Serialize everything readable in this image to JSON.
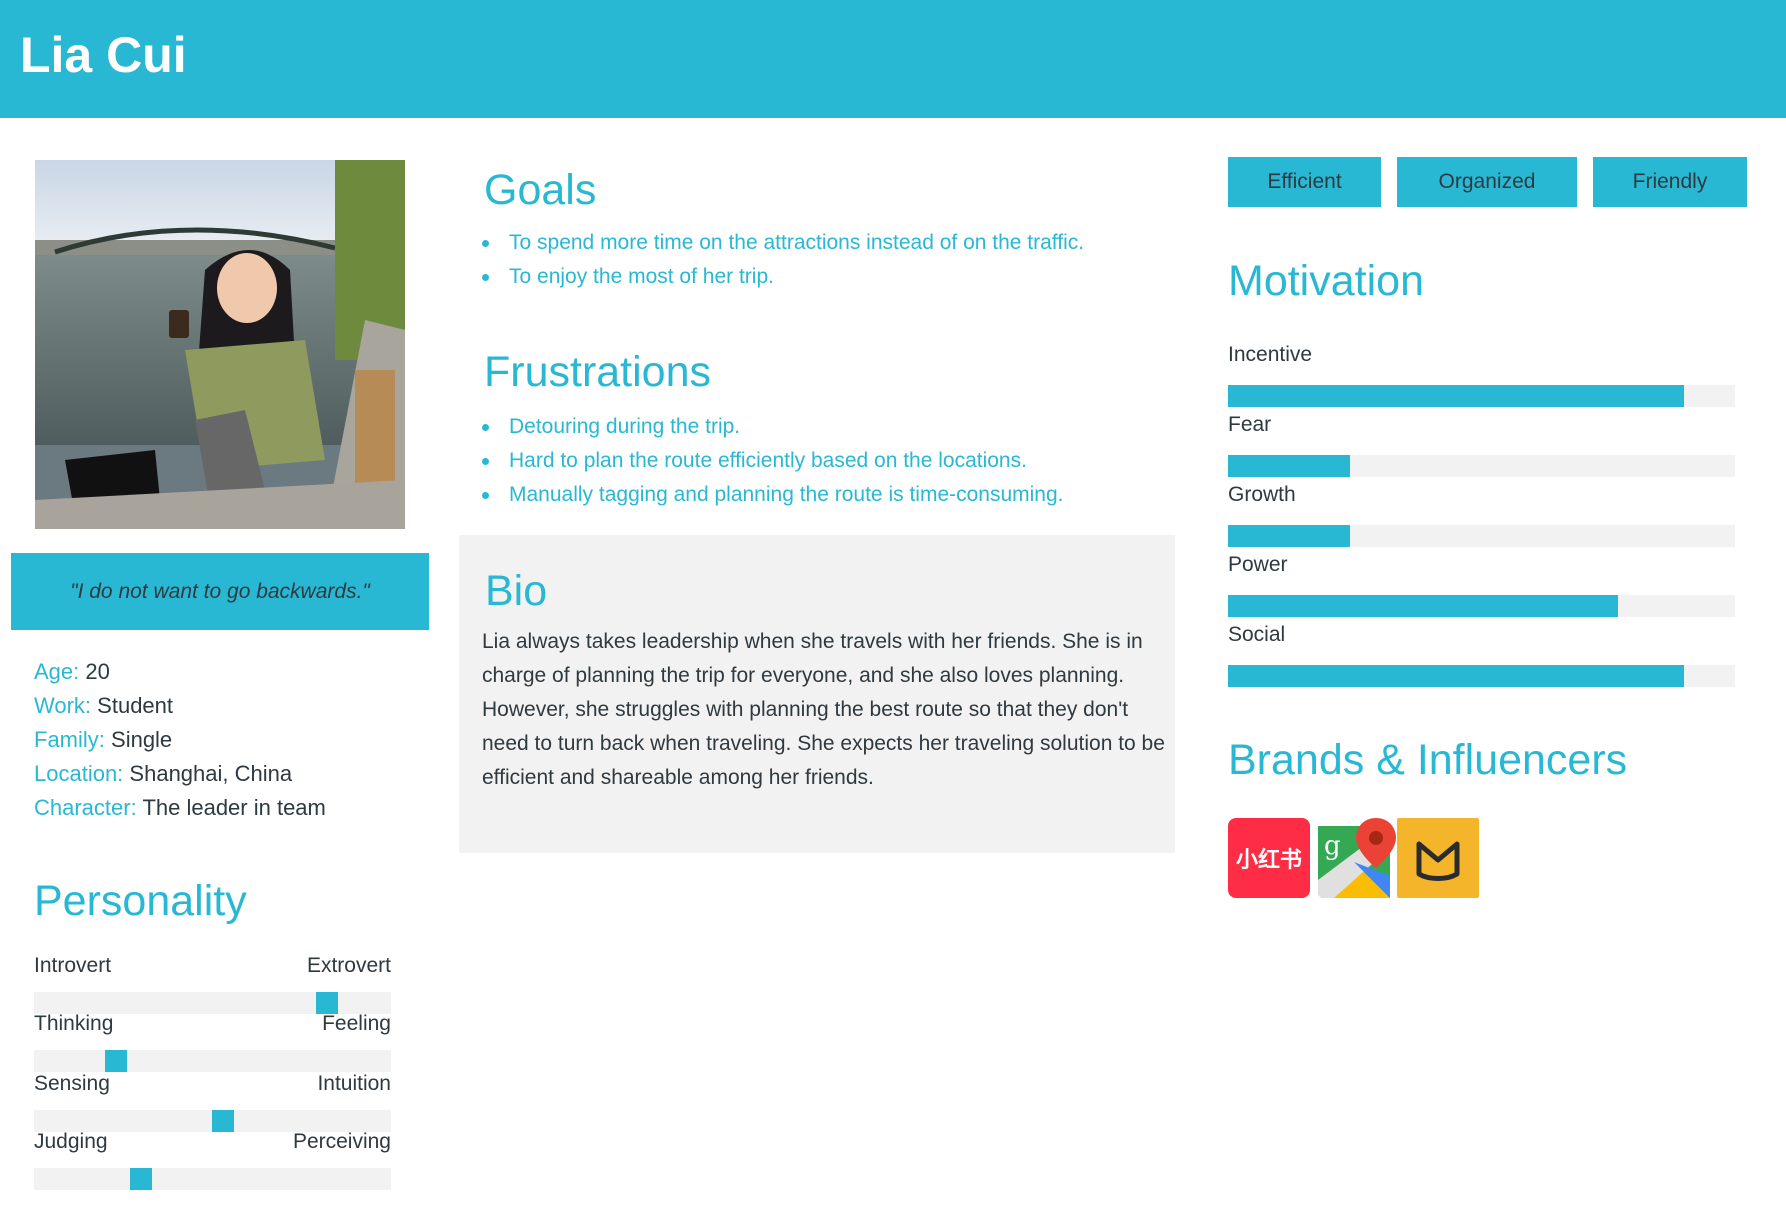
{
  "name": "Lia Cui",
  "photo_icon": "persona-photo",
  "quote": "\"I do not want to go backwards.\"",
  "info": [
    {
      "key": "Age:",
      "value": "20"
    },
    {
      "key": "Work:",
      "value": "Student"
    },
    {
      "key": "Family:",
      "value": "Single"
    },
    {
      "key": "Location:",
      "value": "Shanghai, China"
    },
    {
      "key": "Character:",
      "value": "The leader in team"
    }
  ],
  "personality": {
    "title": "Personality",
    "scales": [
      {
        "left": "Introvert",
        "right": "Extrovert",
        "value": 0.82
      },
      {
        "left": "Thinking",
        "right": "Feeling",
        "value": 0.23
      },
      {
        "left": "Sensing",
        "right": "Intuition",
        "value": 0.53
      },
      {
        "left": "Judging",
        "right": "Perceiving",
        "value": 0.3
      }
    ]
  },
  "goals": {
    "title": "Goals",
    "items": [
      "To spend more time on the attractions instead of on the traffic.",
      "To enjoy the most of her trip."
    ]
  },
  "frustrations": {
    "title": "Frustrations",
    "items": [
      "Detouring during the trip.",
      "Hard to plan the route efficiently based on the locations.",
      "Manually tagging and planning the route is time-consuming."
    ]
  },
  "bio": {
    "title": "Bio",
    "text": "Lia always takes leadership when she travels with her friends. She is in charge of planning the trip for everyone, and she also loves planning. However, she struggles with planning the best route so that they don't need to turn back when traveling. She expects her traveling solution to be efficient and shareable among her friends."
  },
  "tags": [
    "Efficient",
    "Organized",
    "Friendly"
  ],
  "motivation": {
    "title": "Motivation",
    "items": [
      {
        "label": "Incentive",
        "value": 0.9
      },
      {
        "label": "Fear",
        "value": 0.24
      },
      {
        "label": "Growth",
        "value": 0.24
      },
      {
        "label": "Power",
        "value": 0.77
      },
      {
        "label": "Social",
        "value": 0.9
      }
    ]
  },
  "brands": {
    "title": "Brands & Influencers",
    "logos": [
      {
        "icon": "xiaohongshu-icon",
        "text": "小红书"
      },
      {
        "icon": "google-maps-icon"
      },
      {
        "icon": "mafengwo-icon"
      }
    ]
  },
  "colors": {
    "accent": "#29b8d4",
    "track": "#f2f2f2",
    "text": "#2e3a40"
  }
}
